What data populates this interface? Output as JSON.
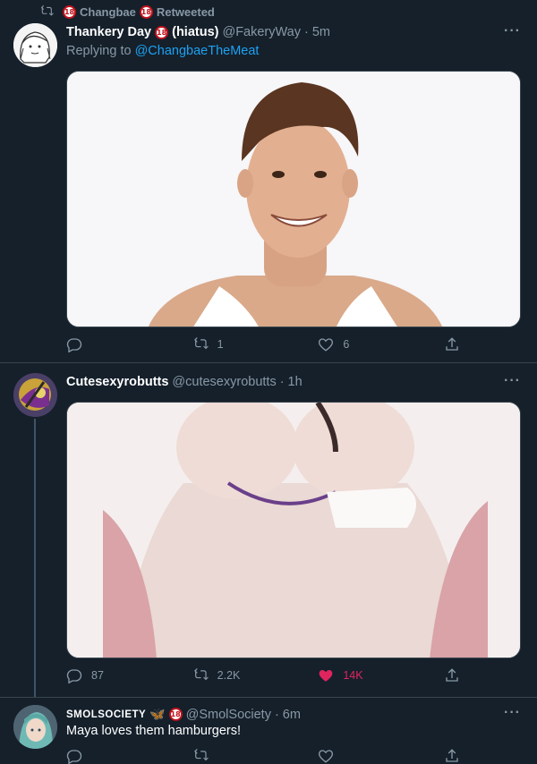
{
  "retweet_header": {
    "user": "Changbae",
    "suffix": "Retweeted"
  },
  "tweets": [
    {
      "name": "Thankery Day",
      "name_suffix": "(hiatus)",
      "handle": "@FakeryWay",
      "time": "5m",
      "replying_prefix": "Replying to",
      "replying_to": "@ChangbaeTheMeat",
      "media": "photo-smiling-man-tank-top",
      "reply_count": "",
      "retweet_count": "1",
      "like_count": "6"
    },
    {
      "name": "Cutesexyrobutts",
      "handle": "@cutesexyrobutts",
      "time": "1h",
      "media": "illustration-artwork",
      "reply_count": "87",
      "retweet_count": "2.2K",
      "like_count": "14K",
      "liked": true
    },
    {
      "name": "SMOLSOCIETY",
      "handle": "@SmolSociety",
      "time": "6m",
      "text": "Maya loves them hamburgers!"
    }
  ],
  "colors": {
    "background": "#15202b",
    "link": "#1da1f2",
    "like": "#e0245e",
    "secondary": "#8899a6"
  },
  "icons": {
    "more": "···",
    "badge": "18",
    "butterfly": "🦋"
  }
}
